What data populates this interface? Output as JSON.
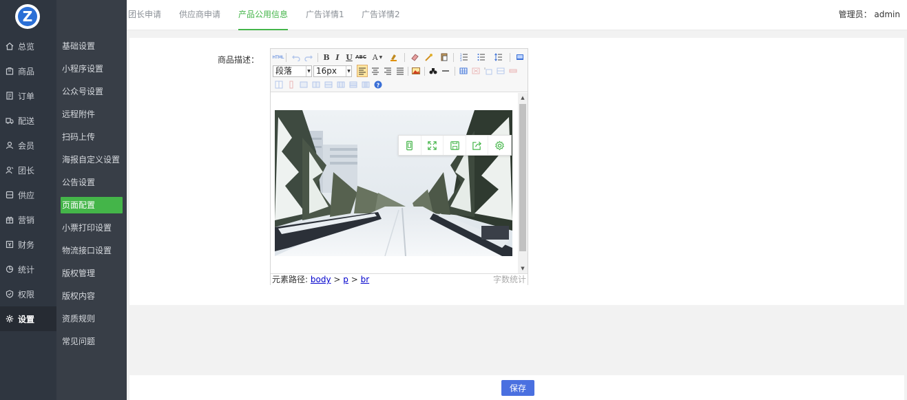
{
  "brand": {
    "logo_letter": "Z",
    "color": "#2a6fd6"
  },
  "main_nav": [
    {
      "label": "总览",
      "icon": "home-icon"
    },
    {
      "label": "商品",
      "icon": "goods-icon"
    },
    {
      "label": "订单",
      "icon": "order-icon"
    },
    {
      "label": "配送",
      "icon": "delivery-icon"
    },
    {
      "label": "会员",
      "icon": "member-icon"
    },
    {
      "label": "团长",
      "icon": "leader-icon"
    },
    {
      "label": "供应",
      "icon": "supply-icon"
    },
    {
      "label": "营销",
      "icon": "gift-icon"
    },
    {
      "label": "财务",
      "icon": "finance-icon"
    },
    {
      "label": "统计",
      "icon": "chart-icon"
    },
    {
      "label": "权限",
      "icon": "shield-icon"
    },
    {
      "label": "设置",
      "icon": "gear-icon",
      "active": true
    }
  ],
  "sub_nav": [
    {
      "label": "基础设置"
    },
    {
      "label": "小程序设置"
    },
    {
      "label": "公众号设置"
    },
    {
      "label": "远程附件"
    },
    {
      "label": "扫码上传"
    },
    {
      "label": "海报自定义设置"
    },
    {
      "label": "公告设置"
    },
    {
      "label": "页面配置",
      "active": true
    },
    {
      "label": "小票打印设置"
    },
    {
      "label": "物流接口设置"
    },
    {
      "label": "版权管理"
    },
    {
      "label": "版权内容"
    },
    {
      "label": "资质规则"
    },
    {
      "label": "常见问题"
    }
  ],
  "tabs": [
    {
      "label": "团长申请"
    },
    {
      "label": "供应商申请"
    },
    {
      "label": "产品公用信息",
      "active": true
    },
    {
      "label": "广告详情1"
    },
    {
      "label": "广告详情2"
    }
  ],
  "header": {
    "admin_label": "管理员： admin"
  },
  "form": {
    "label": "商品描述："
  },
  "editor": {
    "html_button": "HTML",
    "paragraph_select": "段落",
    "fontsize_select": "16px",
    "status_prefix": "元素路径:",
    "path": [
      "body",
      "p",
      "br"
    ],
    "path_sep": ">",
    "word_count": "字数统计"
  },
  "footer": {
    "save_label": "保存"
  },
  "colors": {
    "accent": "#44b549",
    "sidebar": "#2f3640",
    "submenu": "#383e47",
    "save": "#4a70e0"
  }
}
